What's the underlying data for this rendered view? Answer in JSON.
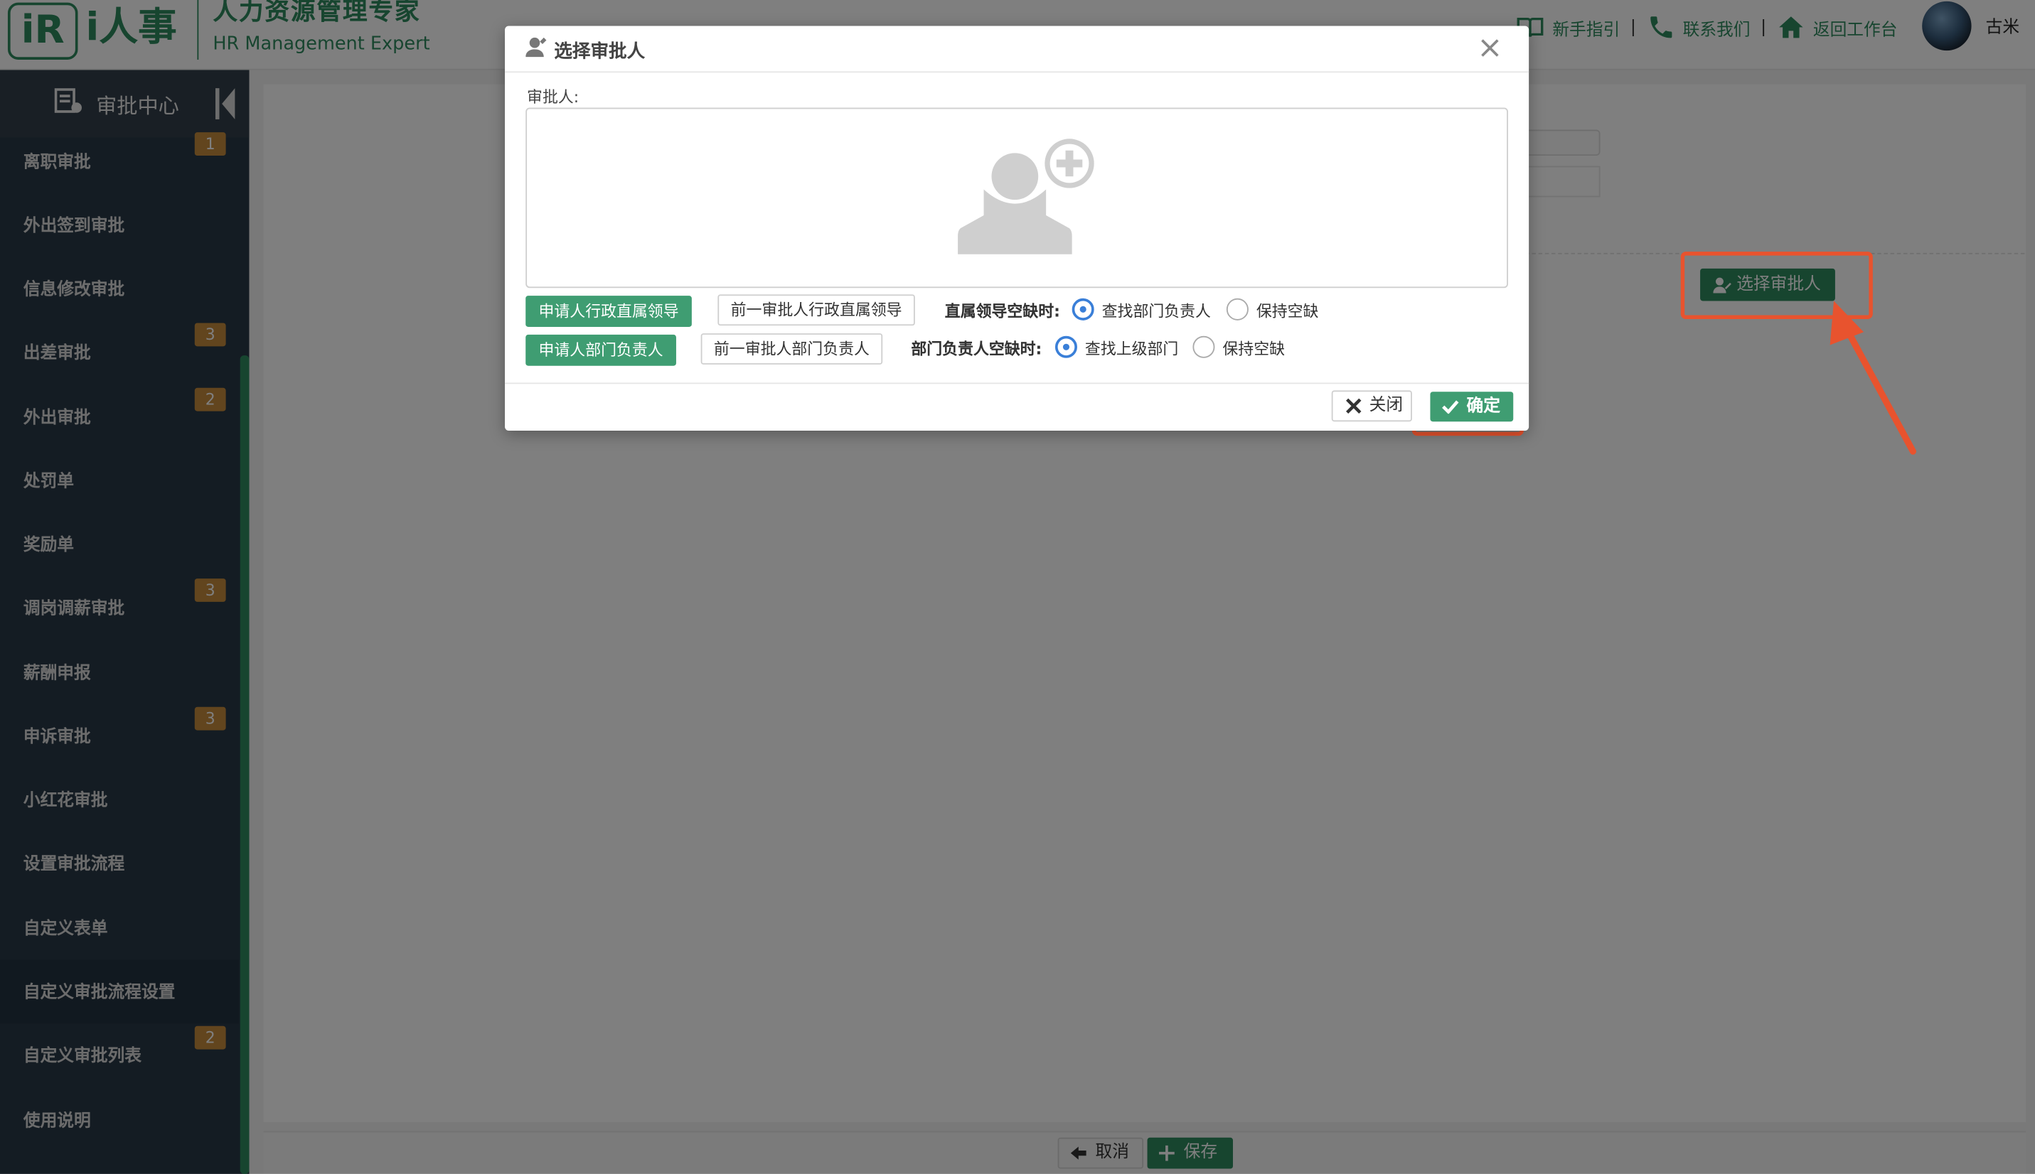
{
  "header": {
    "logo_mark": "iR",
    "logo_name": "i人事",
    "logo_sub_cn": "人力资源管理专家",
    "logo_sub_en": "HR Management Expert",
    "links": [
      {
        "label": "新手指引",
        "icon": "guide-icon"
      },
      {
        "label": "联系我们",
        "icon": "phone-icon"
      },
      {
        "label": "返回工作台",
        "icon": "home-icon"
      }
    ],
    "separator": "|",
    "username": "古米"
  },
  "sidebar": {
    "title": "审批中心",
    "items": [
      {
        "label": "离职审批",
        "badge": "1"
      },
      {
        "label": "外出签到审批",
        "badge": ""
      },
      {
        "label": "信息修改审批",
        "badge": ""
      },
      {
        "label": "出差审批",
        "badge": "3"
      },
      {
        "label": "外出审批",
        "badge": "2"
      },
      {
        "label": "处罚单",
        "badge": ""
      },
      {
        "label": "奖励单",
        "badge": ""
      },
      {
        "label": "调岗调薪审批",
        "badge": "3"
      },
      {
        "label": "薪酬申报",
        "badge": ""
      },
      {
        "label": "申诉审批",
        "badge": "3"
      },
      {
        "label": "小红花审批",
        "badge": ""
      },
      {
        "label": "设置审批流程",
        "badge": ""
      },
      {
        "label": "自定义表单",
        "badge": ""
      },
      {
        "label": "自定义审批流程设置",
        "badge": ""
      },
      {
        "label": "自定义审批列表",
        "badge": "2"
      },
      {
        "label": "使用说明",
        "badge": ""
      }
    ],
    "active_index": 13
  },
  "content": {
    "select_approver_button": "选择审批人",
    "footer": {
      "cancel": "取消",
      "save": "保存"
    }
  },
  "modal": {
    "title": "选择审批人",
    "approver_label": "审批人:",
    "row1": {
      "btn_primary": "申请人行政直属领导",
      "btn_secondary": "前一审批人行政直属领导",
      "option_label": "直属领导空缺时:",
      "radio1": "查找部门负责人",
      "radio2": "保持空缺",
      "selected": 1
    },
    "row2": {
      "btn_primary": "申请人部门负责人",
      "btn_secondary": "前一审批人部门负责人",
      "option_label": "部门负责人空缺时:",
      "radio1": "查找上级部门",
      "radio2": "保持空缺",
      "selected": 1
    },
    "close_label": "关闭",
    "ok_label": "确定"
  },
  "colors": {
    "brand": "#2f8a5f",
    "button_green": "#3f9d72",
    "sidebar_bg": "#283846",
    "badge": "#c58a3c",
    "annotation": "#e8532e",
    "radio": "#3a7fd8"
  }
}
